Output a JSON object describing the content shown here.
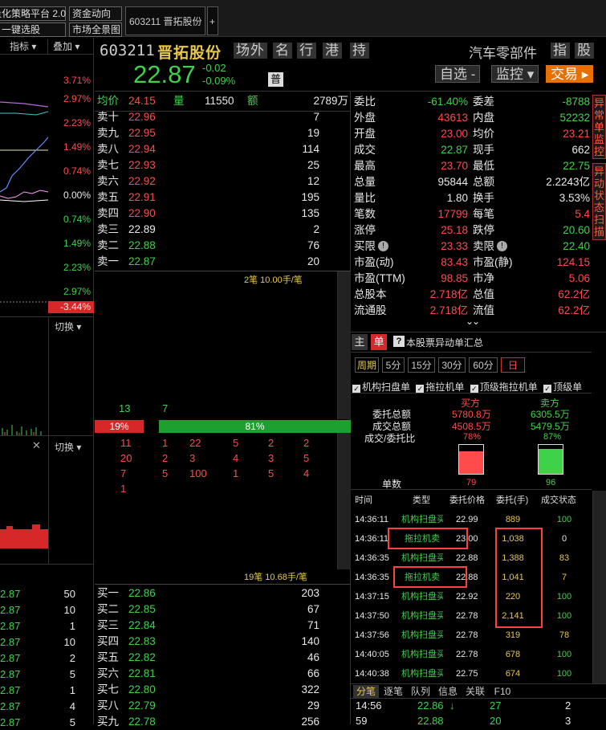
{
  "topbar": {
    "buttons": [
      "量化策略平台 2.0",
      "资金动向",
      "一键选股",
      "市场全景图"
    ],
    "stock_tab": "603211 晋拓股份",
    "add_tab": "+"
  },
  "left": {
    "toolbar": [
      "指标 ▾",
      "叠加 ▾"
    ],
    "pct_labels": [
      "3.71%",
      "2.97%",
      "2.23%",
      "1.49%",
      "0.74%",
      "0.00%",
      "0.74%",
      "1.49%",
      "2.23%",
      "2.97%",
      "-3.44%"
    ],
    "switch1": "切换 ▾",
    "switch2": "切换 ▾",
    "close": "✕",
    "ticks": [
      {
        "price": "2.87",
        "vol": "50"
      },
      {
        "price": "2.87",
        "vol": "10"
      },
      {
        "price": "2.87",
        "vol": "1"
      },
      {
        "price": "2.87",
        "vol": "10"
      },
      {
        "price": "2.87",
        "vol": "2"
      },
      {
        "price": "2.87",
        "vol": "5"
      },
      {
        "price": "2.87",
        "vol": "1"
      },
      {
        "price": "2.87",
        "vol": "4"
      },
      {
        "price": "2.87",
        "vol": "5"
      }
    ]
  },
  "header": {
    "code": "603211",
    "name": "晋拓股份",
    "tags": [
      "场外",
      "名",
      "行",
      "港",
      "持"
    ],
    "industry": "汽车零部件",
    "tags2": [
      "指",
      "股"
    ],
    "price": "22.87",
    "change": "-0.02",
    "change_pct": "-0.09%",
    "badge": "普",
    "btn_watch": "自选 -",
    "btn_monitor": "监控 ▾",
    "btn_trade": "交易 ▸"
  },
  "book": {
    "avg_label": "均价",
    "avg_value": "24.15",
    "vol_label": "量",
    "vol_value": "11550",
    "amt_label": "额",
    "amt_value": "2789万",
    "asks": [
      {
        "label": "卖十",
        "price": "22.96",
        "vol": "7"
      },
      {
        "label": "卖九",
        "price": "22.95",
        "vol": "19"
      },
      {
        "label": "卖八",
        "price": "22.94",
        "vol": "114"
      },
      {
        "label": "卖七",
        "price": "22.93",
        "vol": "25"
      },
      {
        "label": "卖六",
        "price": "22.92",
        "vol": "12"
      },
      {
        "label": "卖五",
        "price": "22.91",
        "vol": "195"
      },
      {
        "label": "卖四",
        "price": "22.90",
        "vol": "135"
      },
      {
        "label": "卖三",
        "price": "22.89",
        "vol": "2"
      },
      {
        "label": "卖二",
        "price": "22.88",
        "vol": "76"
      },
      {
        "label": "卖一",
        "price": "22.87",
        "vol": "20"
      }
    ],
    "ask_summary": "2笔 10.00手/笔",
    "mid_counts": [
      "13",
      "7"
    ],
    "ratio_left": "19%",
    "ratio_right": "81%",
    "ratio_value": 0.19,
    "queue_rows": [
      [
        "11",
        "1",
        "22",
        "5",
        "2",
        "2"
      ],
      [
        "20",
        "2",
        "3",
        "4",
        "3",
        "5"
      ],
      [
        "7",
        "5",
        "100",
        "1",
        "5",
        "4"
      ],
      [
        "1",
        "",
        "",
        "",
        "",
        ""
      ]
    ],
    "bid_summary": "19笔 10.68手/笔",
    "bids": [
      {
        "label": "买一",
        "price": "22.86",
        "vol": "203"
      },
      {
        "label": "买二",
        "price": "22.85",
        "vol": "67"
      },
      {
        "label": "买三",
        "price": "22.84",
        "vol": "71"
      },
      {
        "label": "买四",
        "price": "22.83",
        "vol": "140"
      },
      {
        "label": "买五",
        "price": "22.82",
        "vol": "46"
      },
      {
        "label": "买六",
        "price": "22.81",
        "vol": "66"
      },
      {
        "label": "买七",
        "price": "22.80",
        "vol": "322"
      },
      {
        "label": "买八",
        "price": "22.79",
        "vol": "29"
      },
      {
        "label": "买九",
        "price": "22.78",
        "vol": "256"
      }
    ]
  },
  "stats": [
    {
      "l1": "委比",
      "v1": "-61.40%",
      "c1": "grn",
      "l2": "委差",
      "v2": "-8788",
      "c2": "grn"
    },
    {
      "l1": "外盘",
      "v1": "43613",
      "c1": "red",
      "l2": "内盘",
      "v2": "52232",
      "c2": "grn"
    },
    {
      "l1": "开盘",
      "v1": "23.00",
      "c1": "red",
      "l2": "均价",
      "v2": "23.21",
      "c2": "red"
    },
    {
      "l1": "成交",
      "v1": "22.87",
      "c1": "grn",
      "l2": "现手",
      "v2": "662",
      "c2": "wht"
    },
    {
      "l1": "最高",
      "v1": "23.70",
      "c1": "red",
      "l2": "最低",
      "v2": "22.75",
      "c2": "grn"
    },
    {
      "l1": "总量",
      "v1": "95844",
      "c1": "wht",
      "l2": "总额",
      "v2": "2.2243亿",
      "c2": "wht"
    },
    {
      "l1": "量比",
      "v1": "1.80",
      "c1": "wht",
      "l2": "换手",
      "v2": "3.53%",
      "c2": "wht"
    },
    {
      "l1": "笔数",
      "v1": "17799",
      "c1": "red",
      "l2": "每笔",
      "v2": "5.4",
      "c2": "red"
    },
    {
      "l1": "涨停",
      "v1": "25.18",
      "c1": "red",
      "l2": "跌停",
      "v2": "20.60",
      "c2": "grn"
    },
    {
      "l1": "买限",
      "v1": "23.33",
      "c1": "red",
      "l2": "卖限",
      "v2": "22.40",
      "c2": "grn"
    },
    {
      "l1": "市盈(动)",
      "v1": "83.43",
      "c1": "red",
      "l2": "市盈(静)",
      "v2": "124.15",
      "c2": "red"
    },
    {
      "l1": "市盈(TTM)",
      "v1": "98.85",
      "c1": "red",
      "l2": "市净",
      "v2": "5.06",
      "c2": "red"
    },
    {
      "l1": "总股本",
      "v1": "2.718亿",
      "c1": "red",
      "l2": "总值",
      "v2": "62.2亿",
      "c2": "red"
    },
    {
      "l1": "流通股",
      "v1": "2.718亿",
      "c1": "red",
      "l2": "流值",
      "v2": "62.2亿",
      "c2": "red"
    }
  ],
  "expand": "⌄⌄",
  "side_tabs": [
    "异常单监控",
    "异动状态扫描"
  ],
  "panel": {
    "tab_main": "主",
    "tab_single": "单",
    "title": "本股票异动单汇总",
    "periods": [
      "周期",
      "5分",
      "15分",
      "30分",
      "60分",
      "日"
    ],
    "filters": [
      "机构扫盘单",
      "拖拉机单",
      "顶级拖拉机单",
      "顶级单"
    ],
    "buy_label": "买方",
    "sell_label": "卖方",
    "row_labels": [
      "委托总额",
      "成交总额",
      "成交/委托比"
    ],
    "buy_values": [
      "5780.8万",
      "4508.5万",
      "78%"
    ],
    "sell_values": [
      "6305.5万",
      "5479.5万",
      "87%"
    ],
    "buy_fill": 0.78,
    "sell_fill": 0.87,
    "count_label": "单数",
    "buy_count": "79",
    "sell_count": "96",
    "table_headers": [
      "时间",
      "类型",
      "委托价格",
      "委托(手)",
      "成交状态"
    ],
    "rows": [
      {
        "time": "14:36:11",
        "type": "机构扫盘买",
        "price": "22.99",
        "qty": "889",
        "status": "100"
      },
      {
        "time": "14:36:11",
        "type": "拖拉机卖",
        "price": "23.00",
        "qty": "1,038",
        "status": "0"
      },
      {
        "time": "14:36:35",
        "type": "机构扫盘买",
        "price": "22.88",
        "qty": "1,388",
        "status": "83"
      },
      {
        "time": "14:36:35",
        "type": "拖拉机卖",
        "price": "22.88",
        "qty": "1,041",
        "status": "7"
      },
      {
        "time": "14:37:15",
        "type": "机构扫盘买",
        "price": "22.92",
        "qty": "220",
        "status": "100"
      },
      {
        "time": "14:37:50",
        "type": "机构扫盘买",
        "price": "22.78",
        "qty": "2,141",
        "status": "100"
      },
      {
        "time": "14:37:56",
        "type": "机构扫盘买",
        "price": "22.78",
        "qty": "319",
        "status": "78"
      },
      {
        "time": "14:40:05",
        "type": "机构扫盘买",
        "price": "22.78",
        "qty": "678",
        "status": "100"
      },
      {
        "time": "14:40:38",
        "type": "机构扫盘买",
        "price": "22.75",
        "qty": "674",
        "status": "100"
      }
    ],
    "bottom_tabs": [
      "分笔",
      "逐笔",
      "队列",
      "信息",
      "关联",
      "F10"
    ],
    "trades": [
      {
        "time": "14:56",
        "price": "22.86",
        "arrow": "↓",
        "vol": "27",
        "num": "2"
      },
      {
        "time": "59",
        "price": "22.88",
        "arrow": "",
        "vol": "20",
        "num": "3"
      }
    ]
  },
  "colors": {
    "red": "#ff4b4b",
    "green": "#3fd14a",
    "orange": "#ff7a00",
    "highlight": "#ff4040"
  }
}
